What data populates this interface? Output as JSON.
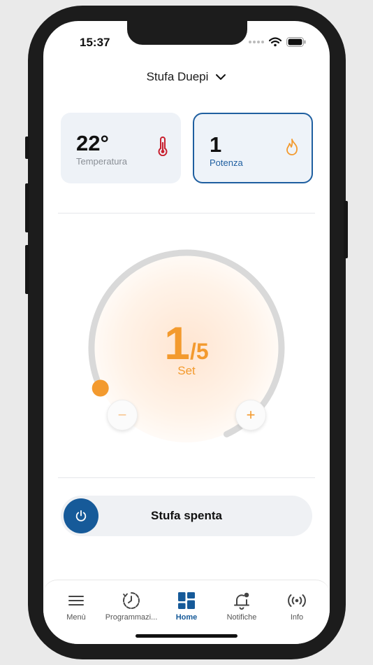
{
  "status_bar": {
    "time": "15:37"
  },
  "header": {
    "title": "Stufa Duepi"
  },
  "cards": {
    "temperature": {
      "value": "22°",
      "label": "Temperatura",
      "icon": "thermometer-icon"
    },
    "power": {
      "value": "1",
      "label": "Potenza",
      "icon": "flame-icon"
    }
  },
  "dial": {
    "current": "1",
    "max": "/5",
    "label": "Set",
    "level": 0.2,
    "minus": "−",
    "plus": "+"
  },
  "power_toggle": {
    "label": "Stufa spenta",
    "icon": "power-icon"
  },
  "tabs": [
    {
      "label": "Menù",
      "icon": "menu-icon"
    },
    {
      "label": "Programmazi...",
      "icon": "schedule-icon"
    },
    {
      "label": "Home",
      "icon": "grid-icon"
    },
    {
      "label": "Notifiche",
      "icon": "bell-icon"
    },
    {
      "label": "Info",
      "icon": "broadcast-icon"
    }
  ],
  "colors": {
    "accent": "#f39a2e",
    "primary": "#165a99",
    "thermometer": "#c8202f"
  }
}
